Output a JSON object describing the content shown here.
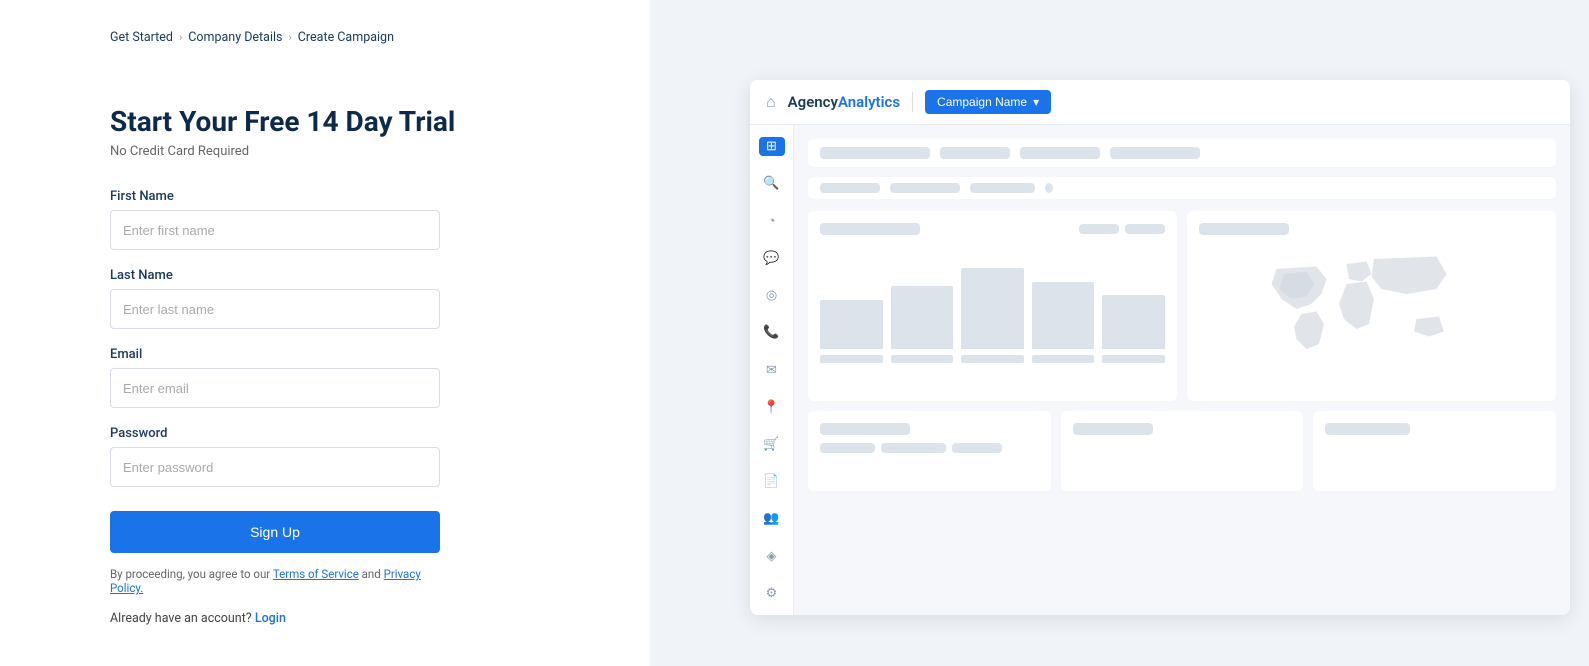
{
  "breadcrumb": {
    "items": [
      "Get Started",
      "Company Details",
      "Create Campaign"
    ],
    "sep": ">"
  },
  "form": {
    "title": "Start Your Free 14 Day Trial",
    "subtitle": "No Credit Card Required",
    "fields": {
      "first_name": {
        "label": "First Name",
        "placeholder": "Enter first name"
      },
      "last_name": {
        "label": "Last Name",
        "placeholder": "Enter last name"
      },
      "email": {
        "label": "Email",
        "placeholder": "Enter email"
      },
      "password": {
        "label": "Password",
        "placeholder": "Enter password"
      }
    },
    "signup_btn": "Sign Up",
    "terms_prefix": "By proceeding, you agree to our ",
    "terms_link": "Terms of Service",
    "terms_mid": " and ",
    "privacy_link": "Privacy Policy.",
    "login_text": "Already have an account?",
    "login_link": "Login"
  },
  "dashboard": {
    "logo_agency": "Agency",
    "logo_analytics": "Analytics",
    "campaign_btn": "Campaign Name",
    "nav": {
      "home_icon": "⌂"
    }
  }
}
